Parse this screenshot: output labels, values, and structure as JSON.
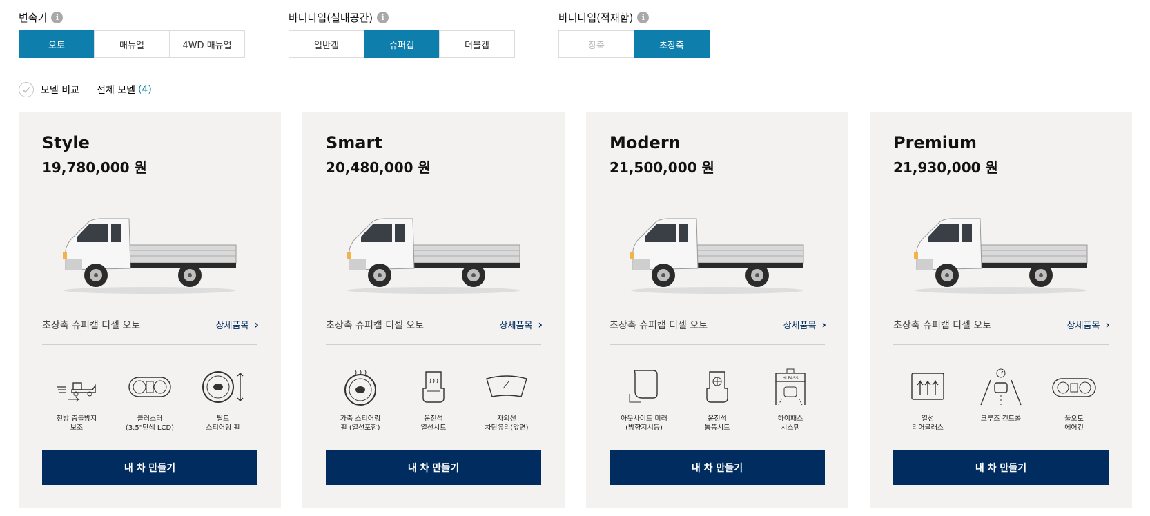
{
  "filters": {
    "transmission": {
      "title": "변속기",
      "options": [
        "오토",
        "매뉴얼",
        "4WD 매뉴얼"
      ],
      "active": 0
    },
    "cabin": {
      "title": "바디타입(실내공간)",
      "options": [
        "일반캡",
        "슈퍼캡",
        "더블캡"
      ],
      "active": 1
    },
    "cargo": {
      "title": "바디타입(적재함)",
      "options": [
        "장축",
        "초장축"
      ],
      "active": 1,
      "disabled": 0
    }
  },
  "compare": {
    "label": "모델 비교",
    "all_models": "전체 모델",
    "count": "(4)"
  },
  "cards": [
    {
      "name": "Style",
      "price": "19,780,000 원",
      "desc": "초장축 슈퍼캡 디젤 오토",
      "detail": "상세품목",
      "features": [
        "전방 충돌방지\n보조",
        "클러스터\n(3.5\"단색 LCD)",
        "틸트\n스티어링 휠"
      ],
      "icons": [
        "collision-avoidance-icon",
        "cluster-icon",
        "tilt-steering-icon"
      ],
      "button": "내 차 만들기"
    },
    {
      "name": "Smart",
      "price": "20,480,000 원",
      "desc": "초장축 슈퍼캡 디젤 오토",
      "detail": "상세품목",
      "features": [
        "가죽 스티어링\n휠 (열선포함)",
        "운전석\n열선시트",
        "자외선\n차단유리(앞면)"
      ],
      "icons": [
        "heated-steering-icon",
        "heated-seat-icon",
        "uv-glass-icon"
      ],
      "button": "내 차 만들기"
    },
    {
      "name": "Modern",
      "price": "21,500,000 원",
      "desc": "초장축 슈퍼캡 디젤 오토",
      "detail": "상세품목",
      "features": [
        "아웃사이드 미러\n(방향지시등)",
        "운전석\n통풍시트",
        "하이패스\n시스템"
      ],
      "icons": [
        "side-mirror-icon",
        "ventilated-seat-icon",
        "hipass-icon"
      ],
      "button": "내 차 만들기"
    },
    {
      "name": "Premium",
      "price": "21,930,000 원",
      "desc": "초장축 슈퍼캡 디젤 오토",
      "detail": "상세품목",
      "features": [
        "열선\n리어글래스",
        "크루즈 컨트롤",
        "풀오토\n에어컨"
      ],
      "icons": [
        "rear-defrost-icon",
        "cruise-control-icon",
        "auto-aircon-icon"
      ],
      "button": "내 차 만들기"
    }
  ],
  "colors": {
    "accent": "#0e7fad",
    "navy": "#002c5f",
    "card_bg": "#f4f2f0"
  }
}
